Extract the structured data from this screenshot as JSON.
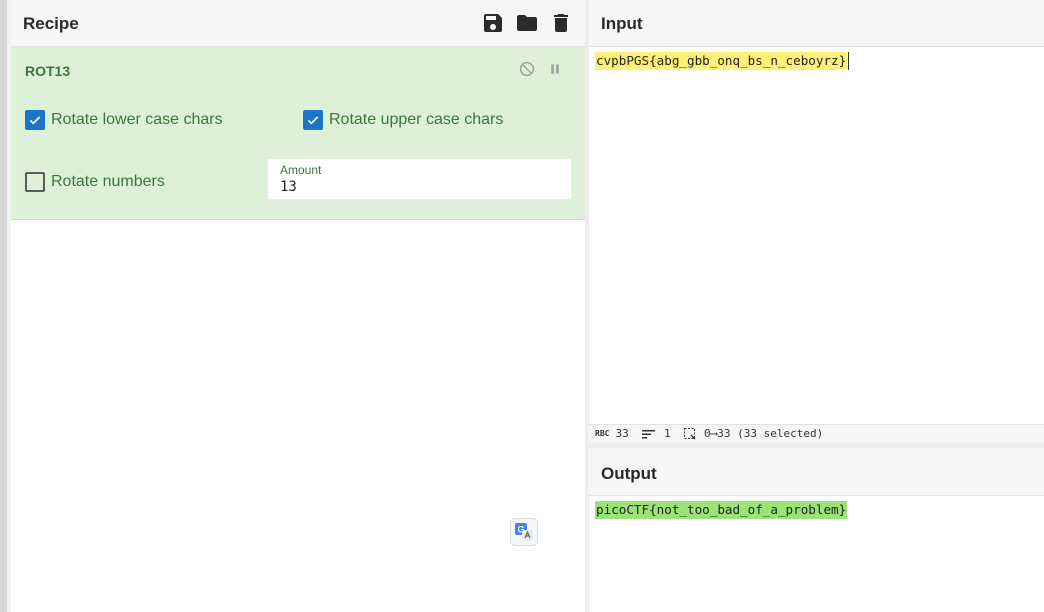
{
  "recipe": {
    "title": "Recipe",
    "icons": [
      "save-icon",
      "folder-icon",
      "trash-icon"
    ]
  },
  "operation": {
    "name": "ROT13",
    "controls": [
      "disable-icon",
      "pause-icon"
    ],
    "options": {
      "rotate_lower": {
        "label": "Rotate lower case chars",
        "checked": true
      },
      "rotate_upper": {
        "label": "Rotate upper case chars",
        "checked": true
      },
      "rotate_numbers": {
        "label": "Rotate numbers",
        "checked": false
      }
    },
    "amount": {
      "label": "Amount",
      "value": "13"
    }
  },
  "input": {
    "title": "Input",
    "text": "cvpbPGS{abg_gbb_onq_bs_n_ceboyrz}"
  },
  "status": {
    "abc_icon": "RBC",
    "length": "33",
    "lines": "1",
    "selection": "0⟶33 (33 selected)"
  },
  "output": {
    "title": "Output",
    "text": "picoCTF{not_too_bad_of_a_problem}"
  },
  "colors": {
    "accent": "#1b74c8",
    "op_bg": "#dff0d8",
    "op_text": "#3c763d",
    "input_highlight": "#fff176",
    "output_highlight": "#9be378"
  }
}
